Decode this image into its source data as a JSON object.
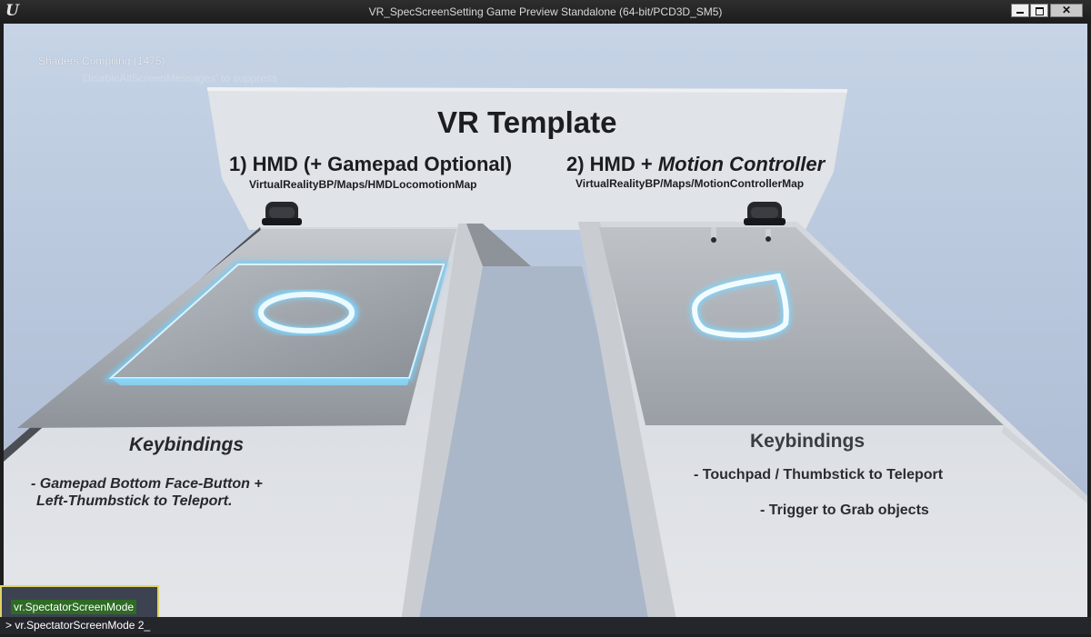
{
  "window": {
    "title": "VR_SpecScreenSetting Game Preview Standalone (64-bit/PCD3D_SM5)",
    "logo_icon": "unreal-engine-logo-icon",
    "controls": [
      "minimize-icon",
      "maximize-icon",
      "close-icon"
    ]
  },
  "screen_messages": {
    "shaders_compiling": "Shaders Compiling (1475)",
    "suppress_hint": "'DisableAllScreenMessages' to suppress"
  },
  "scene": {
    "title": "VR Template",
    "left": {
      "heading": "1) HMD (+ Gamepad Optional)",
      "map_path": "VirtualRealityBP/Maps/HMDLocomotionMap",
      "keybindings_title": "Keybindings",
      "keybinding_line1": "- Gamepad Bottom Face-Button +",
      "keybinding_line2": "Left-Thumbstick to Teleport."
    },
    "right": {
      "heading_prefix": "2) HMD + ",
      "heading_italic": "Motion Controller",
      "map_path": "VirtualRealityBP/Maps/MotionControllerMap",
      "keybindings_title": "Keybindings",
      "keybinding_line1": "- Touchpad / Thumbstick to Teleport",
      "keybinding_line2": "- Trigger to Grab objects"
    }
  },
  "console": {
    "suggestion": "vr.SpectatorScreenMode",
    "prompt": ">",
    "input_value": "vr.SpectatorScreenMode 2_"
  },
  "colors": {
    "sky": "#b8c6dc",
    "panel": "#d9dde3",
    "glow": "#7fd6ff",
    "console_highlight": "#e0d36a",
    "suggestion_bg": "#2e6b25"
  }
}
